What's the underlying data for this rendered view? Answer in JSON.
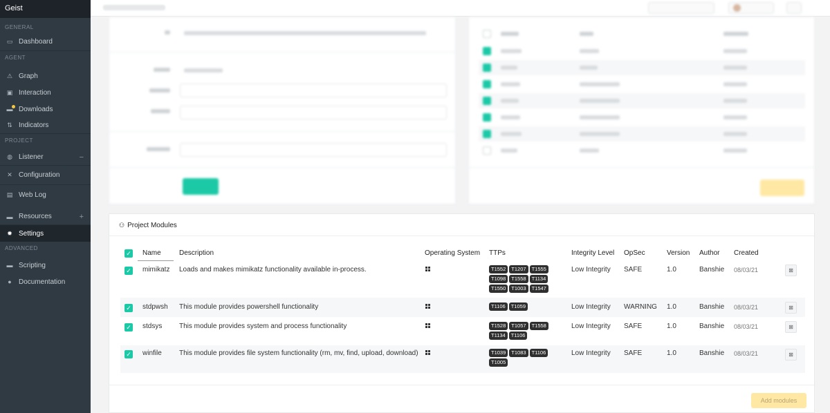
{
  "app": {
    "brand": "Geist"
  },
  "sidebar": {
    "sections": [
      "GENERAL",
      "AGENT",
      "PROJECT",
      "ADVANCED"
    ],
    "items": [
      {
        "label": "Dashboard"
      },
      {
        "label": "Graph"
      },
      {
        "label": "Interaction"
      },
      {
        "label": "Downloads"
      },
      {
        "label": "Indicators"
      },
      {
        "label": "Listener"
      },
      {
        "label": "Configuration"
      },
      {
        "label": "Web Log"
      },
      {
        "label": "Resources"
      },
      {
        "label": "Settings"
      },
      {
        "label": "Scripting"
      },
      {
        "label": "Documentation"
      }
    ],
    "listener_toggle": "−",
    "resources_toggle": "+"
  },
  "modules": {
    "title": "Project Modules",
    "columns": [
      "Name",
      "Description",
      "Operating System",
      "TTPs",
      "Integrity Level",
      "OpSec",
      "Version",
      "Author",
      "Created"
    ],
    "rows": [
      {
        "name": "mimikatz",
        "description": "Loads and makes mimikatz functionality available in-process.",
        "ttps": [
          "T1552",
          "T1207",
          "T1555",
          "T1098",
          "T1558",
          "T1134",
          "T1550",
          "T1003",
          "T1547"
        ],
        "integrity": "Low Integrity",
        "opsec": "SAFE",
        "version": "1.0",
        "author": "Banshie",
        "created": "08/03/21"
      },
      {
        "name": "stdpwsh",
        "description": "This module provides powershell functionality",
        "ttps": [
          "T1106",
          "T1059"
        ],
        "integrity": "Low Integrity",
        "opsec": "WARNING",
        "version": "1.0",
        "author": "Banshie",
        "created": "08/03/21"
      },
      {
        "name": "stdsys",
        "description": "This module provides system and process functionality",
        "ttps": [
          "T1528",
          "T1057",
          "T1558",
          "T1134",
          "T1106"
        ],
        "integrity": "Low Integrity",
        "opsec": "SAFE",
        "version": "1.0",
        "author": "Banshie",
        "created": "08/03/21"
      },
      {
        "name": "winfile",
        "description": "This module provides file system functionality (rm, mv, find, upload, download)",
        "ttps": [
          "T1039",
          "T1083",
          "T1106",
          "T1005"
        ],
        "integrity": "Low Integrity",
        "opsec": "SAFE",
        "version": "1.0",
        "author": "Banshie",
        "created": "08/03/21"
      }
    ],
    "add_button": "Add modules"
  },
  "icons": {
    "checkmark": "✓",
    "os": "windows-icon",
    "row_action": "remove-icon"
  },
  "colors": {
    "accent": "#1bc9a6",
    "sidebar": "#2f3a43",
    "warning_button": "#ffe8a3",
    "ttp_badge": "#2f2f2f"
  }
}
